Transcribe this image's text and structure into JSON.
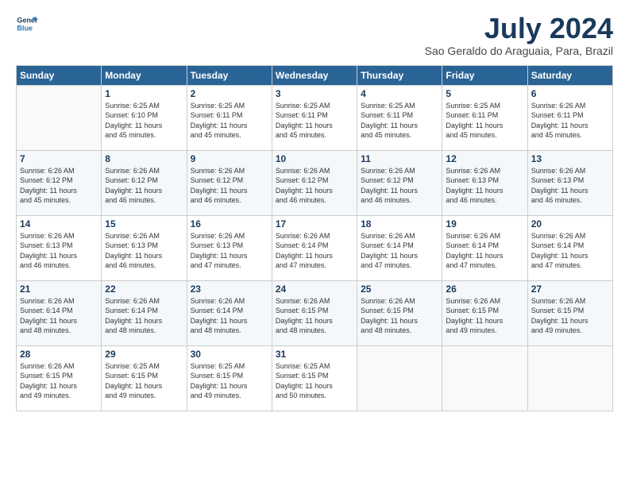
{
  "logo": {
    "line1": "General",
    "line2": "Blue"
  },
  "header": {
    "month": "July 2024",
    "location": "Sao Geraldo do Araguaia, Para, Brazil"
  },
  "weekdays": [
    "Sunday",
    "Monday",
    "Tuesday",
    "Wednesday",
    "Thursday",
    "Friday",
    "Saturday"
  ],
  "weeks": [
    [
      {
        "day": "",
        "info": ""
      },
      {
        "day": "1",
        "info": "Sunrise: 6:25 AM\nSunset: 6:10 PM\nDaylight: 11 hours\nand 45 minutes."
      },
      {
        "day": "2",
        "info": "Sunrise: 6:25 AM\nSunset: 6:11 PM\nDaylight: 11 hours\nand 45 minutes."
      },
      {
        "day": "3",
        "info": "Sunrise: 6:25 AM\nSunset: 6:11 PM\nDaylight: 11 hours\nand 45 minutes."
      },
      {
        "day": "4",
        "info": "Sunrise: 6:25 AM\nSunset: 6:11 PM\nDaylight: 11 hours\nand 45 minutes."
      },
      {
        "day": "5",
        "info": "Sunrise: 6:25 AM\nSunset: 6:11 PM\nDaylight: 11 hours\nand 45 minutes."
      },
      {
        "day": "6",
        "info": "Sunrise: 6:26 AM\nSunset: 6:11 PM\nDaylight: 11 hours\nand 45 minutes."
      }
    ],
    [
      {
        "day": "7",
        "info": "Sunrise: 6:26 AM\nSunset: 6:12 PM\nDaylight: 11 hours\nand 45 minutes."
      },
      {
        "day": "8",
        "info": "Sunrise: 6:26 AM\nSunset: 6:12 PM\nDaylight: 11 hours\nand 46 minutes."
      },
      {
        "day": "9",
        "info": "Sunrise: 6:26 AM\nSunset: 6:12 PM\nDaylight: 11 hours\nand 46 minutes."
      },
      {
        "day": "10",
        "info": "Sunrise: 6:26 AM\nSunset: 6:12 PM\nDaylight: 11 hours\nand 46 minutes."
      },
      {
        "day": "11",
        "info": "Sunrise: 6:26 AM\nSunset: 6:12 PM\nDaylight: 11 hours\nand 46 minutes."
      },
      {
        "day": "12",
        "info": "Sunrise: 6:26 AM\nSunset: 6:13 PM\nDaylight: 11 hours\nand 46 minutes."
      },
      {
        "day": "13",
        "info": "Sunrise: 6:26 AM\nSunset: 6:13 PM\nDaylight: 11 hours\nand 46 minutes."
      }
    ],
    [
      {
        "day": "14",
        "info": "Sunrise: 6:26 AM\nSunset: 6:13 PM\nDaylight: 11 hours\nand 46 minutes."
      },
      {
        "day": "15",
        "info": "Sunrise: 6:26 AM\nSunset: 6:13 PM\nDaylight: 11 hours\nand 46 minutes."
      },
      {
        "day": "16",
        "info": "Sunrise: 6:26 AM\nSunset: 6:13 PM\nDaylight: 11 hours\nand 47 minutes."
      },
      {
        "day": "17",
        "info": "Sunrise: 6:26 AM\nSunset: 6:14 PM\nDaylight: 11 hours\nand 47 minutes."
      },
      {
        "day": "18",
        "info": "Sunrise: 6:26 AM\nSunset: 6:14 PM\nDaylight: 11 hours\nand 47 minutes."
      },
      {
        "day": "19",
        "info": "Sunrise: 6:26 AM\nSunset: 6:14 PM\nDaylight: 11 hours\nand 47 minutes."
      },
      {
        "day": "20",
        "info": "Sunrise: 6:26 AM\nSunset: 6:14 PM\nDaylight: 11 hours\nand 47 minutes."
      }
    ],
    [
      {
        "day": "21",
        "info": "Sunrise: 6:26 AM\nSunset: 6:14 PM\nDaylight: 11 hours\nand 48 minutes."
      },
      {
        "day": "22",
        "info": "Sunrise: 6:26 AM\nSunset: 6:14 PM\nDaylight: 11 hours\nand 48 minutes."
      },
      {
        "day": "23",
        "info": "Sunrise: 6:26 AM\nSunset: 6:14 PM\nDaylight: 11 hours\nand 48 minutes."
      },
      {
        "day": "24",
        "info": "Sunrise: 6:26 AM\nSunset: 6:15 PM\nDaylight: 11 hours\nand 48 minutes."
      },
      {
        "day": "25",
        "info": "Sunrise: 6:26 AM\nSunset: 6:15 PM\nDaylight: 11 hours\nand 48 minutes."
      },
      {
        "day": "26",
        "info": "Sunrise: 6:26 AM\nSunset: 6:15 PM\nDaylight: 11 hours\nand 49 minutes."
      },
      {
        "day": "27",
        "info": "Sunrise: 6:26 AM\nSunset: 6:15 PM\nDaylight: 11 hours\nand 49 minutes."
      }
    ],
    [
      {
        "day": "28",
        "info": "Sunrise: 6:26 AM\nSunset: 6:15 PM\nDaylight: 11 hours\nand 49 minutes."
      },
      {
        "day": "29",
        "info": "Sunrise: 6:25 AM\nSunset: 6:15 PM\nDaylight: 11 hours\nand 49 minutes."
      },
      {
        "day": "30",
        "info": "Sunrise: 6:25 AM\nSunset: 6:15 PM\nDaylight: 11 hours\nand 49 minutes."
      },
      {
        "day": "31",
        "info": "Sunrise: 6:25 AM\nSunset: 6:15 PM\nDaylight: 11 hours\nand 50 minutes."
      },
      {
        "day": "",
        "info": ""
      },
      {
        "day": "",
        "info": ""
      },
      {
        "day": "",
        "info": ""
      }
    ]
  ]
}
